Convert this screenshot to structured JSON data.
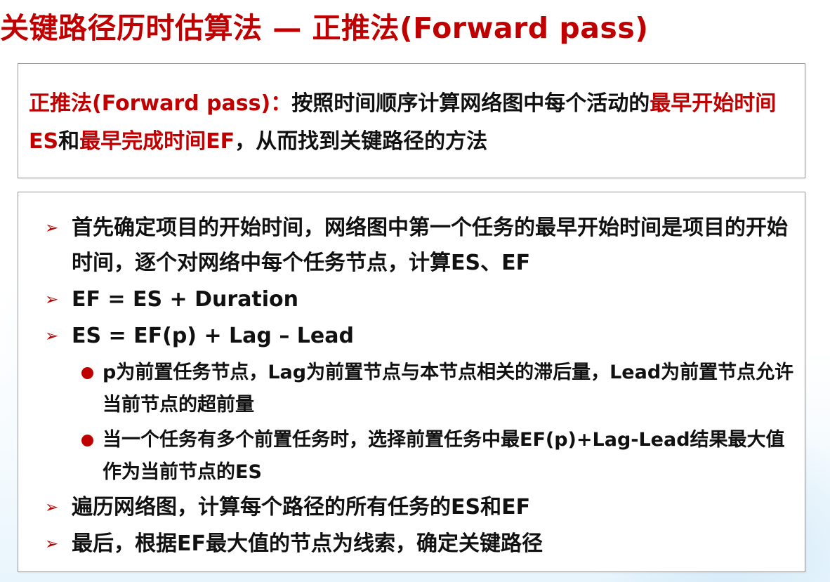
{
  "title": "关键路径历时估算法 — 正推法(Forward pass)",
  "definition": {
    "term": "正推法(Forward pass)：",
    "text_a": "按照时间顺序计算网络图中每个活动的",
    "hl_a": "最早开始时间ES",
    "text_b": "和",
    "hl_b": "最早完成时间EF",
    "text_c": "，从而找到关键路径的方法"
  },
  "bullets": [
    {
      "marker": "arrow-bullet-icon",
      "text": "首先确定项目的开始时间，网络图中第一个任务的最早开始时间是项目的开始时间，逐个对网络中每个任务节点，计算ES、EF"
    },
    {
      "marker": "arrow-bullet-icon",
      "text": "EF = ES + Duration"
    },
    {
      "marker": "arrow-bullet-icon",
      "text": "ES = EF(p) + Lag – Lead"
    },
    {
      "marker": "dot-bullet-icon",
      "text": "p为前置任务节点，Lag为前置节点与本节点相关的滞后量，Lead为前置节点允许当前节点的超前量"
    },
    {
      "marker": "dot-bullet-icon",
      "text": "当一个任务有多个前置任务时，选择前置任务中最EF(p)+Lag-Lead结果最大值作为当前节点的ES"
    },
    {
      "marker": "arrow-bullet-icon",
      "text": "遍历网络图，计算每个路径的所有任务的ES和EF"
    },
    {
      "marker": "arrow-bullet-icon",
      "text": "最后，根据EF最大值的节点为线索，确定关键路径"
    }
  ],
  "colors": {
    "accent": "#c00000",
    "text": "#111111",
    "border": "#9a9a9a"
  }
}
